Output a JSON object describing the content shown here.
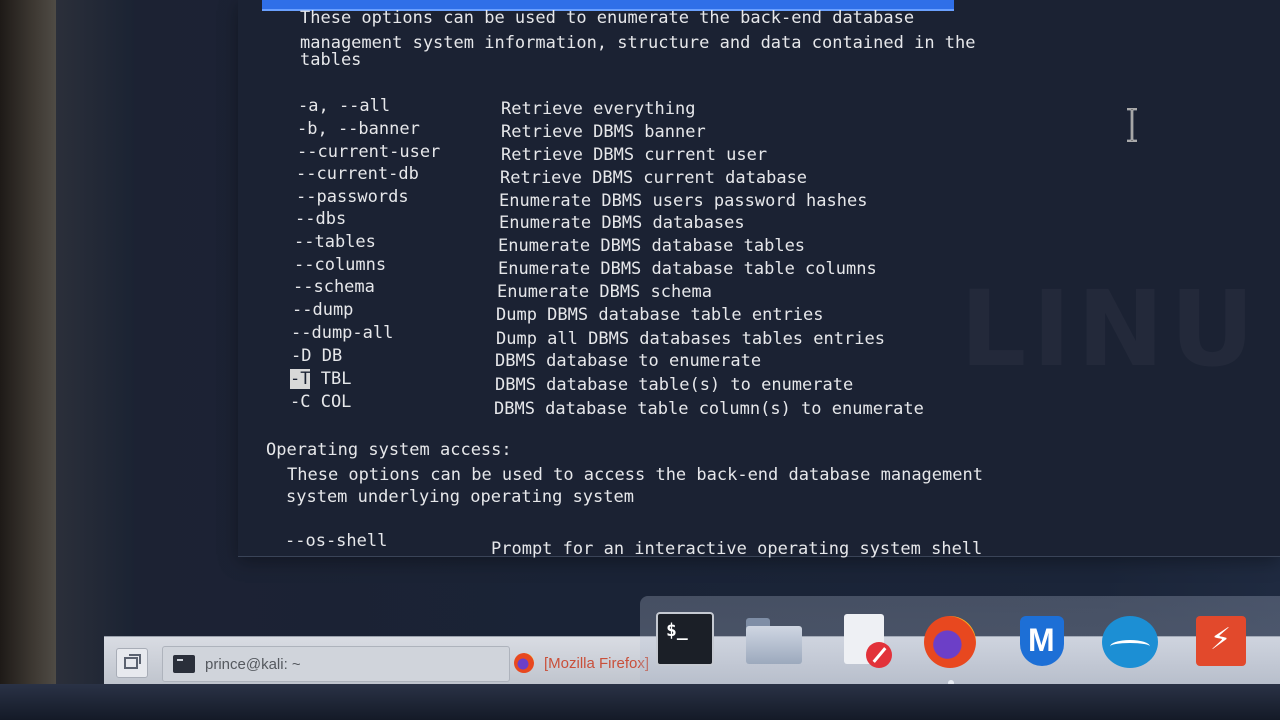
{
  "enumeration": {
    "intro": [
      "These options can be used to enumerate the back-end database",
      "management system information, structure and data contained in the",
      "tables"
    ],
    "options": [
      {
        "flag": "-a, --all",
        "desc": "Retrieve everything"
      },
      {
        "flag": "-b, --banner",
        "desc": "Retrieve DBMS banner"
      },
      {
        "flag": "--current-user",
        "desc": "Retrieve DBMS current user"
      },
      {
        "flag": "--current-db",
        "desc": "Retrieve DBMS current database"
      },
      {
        "flag": "--passwords",
        "desc": "Enumerate DBMS users password hashes"
      },
      {
        "flag": "--dbs",
        "desc": "Enumerate DBMS databases"
      },
      {
        "flag": "--tables",
        "desc": "Enumerate DBMS database tables"
      },
      {
        "flag": "--columns",
        "desc": "Enumerate DBMS database table columns"
      },
      {
        "flag": "--schema",
        "desc": "Enumerate DBMS schema"
      },
      {
        "flag": "--dump",
        "desc": "Dump DBMS database table entries"
      },
      {
        "flag": "--dump-all",
        "desc": "Dump all DBMS databases tables entries"
      },
      {
        "flag": "-D DB",
        "desc": "DBMS database to enumerate"
      },
      {
        "flag_hl": "-T",
        "flag_rest": " TBL",
        "desc": "DBMS database table(s) to enumerate"
      },
      {
        "flag": "-C COL",
        "desc": "DBMS database table column(s) to enumerate"
      }
    ]
  },
  "os_access": {
    "heading": "Operating system access:",
    "intro": [
      "These options can be used to access the back-end database management",
      "system underlying operating system"
    ],
    "options": [
      {
        "flag": "--os-shell",
        "desc": "Prompt for an interactive operating system shell"
      }
    ]
  },
  "watermark": {
    "text": "LINU"
  },
  "taskbar": {
    "tasks": [
      {
        "label": "prince@kali: ~"
      },
      {
        "label": "[Mozilla Firefox]"
      }
    ]
  },
  "dock": {
    "terminal_glyph": "$_",
    "items": [
      "terminal-icon",
      "folder-icon",
      "text-editor-icon",
      "firefox-icon",
      "metasploit-icon",
      "wireshark-icon",
      "burpsuite-icon"
    ]
  },
  "colors": {
    "terminal_bg": "#1b2233",
    "text": "#e6e7ea",
    "accent": "#2f6fe8"
  }
}
